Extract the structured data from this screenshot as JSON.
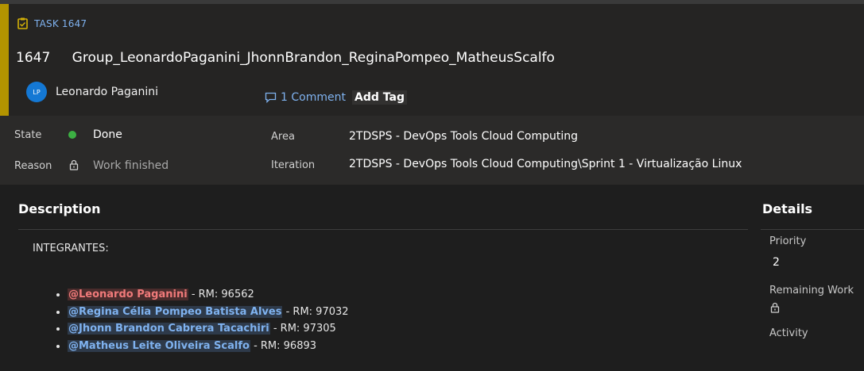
{
  "header": {
    "task_type": "TASK 1647",
    "task_number": "1647",
    "title": "Group_LeonardoPaganini_JhonnBrandon_ReginaPompeo_MatheusScalfo",
    "assignee": {
      "initials": "LP",
      "name": "Leonardo Paganini"
    },
    "comments_label": "1 Comment",
    "add_tag_label": "Add Tag",
    "accent_color": "#b39400"
  },
  "fields": {
    "state_label": "State",
    "state_value": "Done",
    "state_color": "#3cb043",
    "reason_label": "Reason",
    "reason_value": "Work finished",
    "area_label": "Area",
    "area_value": "2TDSPS - DevOps Tools Cloud Computing",
    "iteration_label": "Iteration",
    "iteration_value": "2TDSPS - DevOps Tools Cloud Computing\\Sprint 1 - Virtualização Linux"
  },
  "description": {
    "section_title": "Description",
    "intro": "INTEGRANTES:",
    "members": [
      {
        "mention": "@Leonardo Paganini",
        "rm": " - RM: 96562"
      },
      {
        "mention": "@Regina Célia Pompeo Batista Alves",
        "rm": " - RM: 97032"
      },
      {
        "mention": "@Jhonn Brandon Cabrera Tacachiri",
        "rm": " - RM: 97305"
      },
      {
        "mention": "@Matheus Leite Oliveira Scalfo",
        "rm": " - RM: 96893"
      }
    ]
  },
  "details": {
    "section_title": "Details",
    "priority_label": "Priority",
    "priority_value": "2",
    "remaining_work_label": "Remaining Work",
    "activity_label": "Activity"
  }
}
